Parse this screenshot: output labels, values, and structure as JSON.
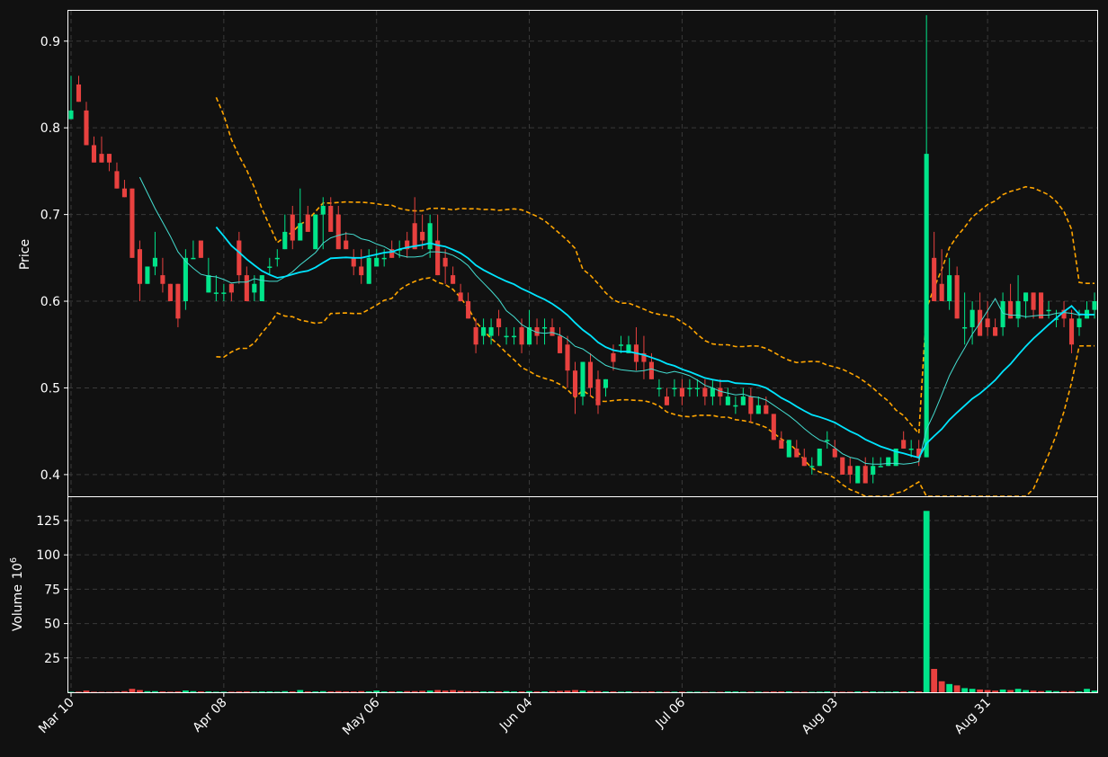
{
  "chart_data": {
    "type": "candlestick",
    "colors": {
      "background": "#111111",
      "up": "#00e58a",
      "down": "#e8413f",
      "ma_long": "#00e5ff",
      "ma_short": "#44ddd0",
      "band": "#ffa500",
      "grid": "#3a3a3a",
      "axis": "#ffffff"
    },
    "x_tick_labels": [
      "Mar 10",
      "Apr 08",
      "May 06",
      "Jun 04",
      "Jul 06",
      "Aug 03",
      "Aug 31"
    ],
    "price_axis": {
      "label": "Price",
      "ylim": [
        0.375,
        0.935
      ],
      "ticks": [
        "0.4",
        "0.5",
        "0.6",
        "0.7",
        "0.8",
        "0.9"
      ]
    },
    "volume_axis": {
      "label": "Volume",
      "unit": "10^6",
      "ylim": [
        0,
        142
      ],
      "ticks": [
        "25",
        "50",
        "75",
        "100",
        "125"
      ]
    },
    "grid": true,
    "candles": {
      "columns": [
        "open",
        "high",
        "low",
        "close",
        "volume_millions"
      ],
      "rows": [
        [
          0.81,
          0.86,
          0.81,
          0.82,
          0.3
        ],
        [
          0.85,
          0.86,
          0.83,
          0.83,
          0.4
        ],
        [
          0.82,
          0.83,
          0.78,
          0.78,
          1.2
        ],
        [
          0.78,
          0.79,
          0.76,
          0.76,
          0.4
        ],
        [
          0.77,
          0.79,
          0.76,
          0.76,
          0.3
        ],
        [
          0.77,
          0.77,
          0.75,
          0.76,
          0.3
        ],
        [
          0.75,
          0.76,
          0.73,
          0.73,
          0.4
        ],
        [
          0.73,
          0.74,
          0.72,
          0.72,
          0.8
        ],
        [
          0.73,
          0.73,
          0.65,
          0.65,
          2.5
        ],
        [
          0.66,
          0.67,
          0.6,
          0.62,
          1.6
        ],
        [
          0.62,
          0.64,
          0.62,
          0.64,
          0.8
        ],
        [
          0.64,
          0.68,
          0.63,
          0.65,
          0.8
        ],
        [
          0.63,
          0.65,
          0.61,
          0.62,
          0.6
        ],
        [
          0.62,
          0.62,
          0.6,
          0.6,
          0.4
        ],
        [
          0.62,
          0.62,
          0.57,
          0.58,
          0.6
        ],
        [
          0.6,
          0.66,
          0.59,
          0.65,
          1.3
        ],
        [
          0.65,
          0.67,
          0.65,
          0.65,
          0.8
        ],
        [
          0.67,
          0.67,
          0.65,
          0.65,
          0.6
        ],
        [
          0.61,
          0.65,
          0.61,
          0.63,
          0.6
        ],
        [
          0.61,
          0.63,
          0.6,
          0.61,
          0.4
        ],
        [
          0.61,
          0.62,
          0.6,
          0.61,
          0.4
        ],
        [
          0.62,
          0.62,
          0.6,
          0.61,
          0.4
        ],
        [
          0.67,
          0.68,
          0.62,
          0.63,
          0.6
        ],
        [
          0.63,
          0.64,
          0.6,
          0.6,
          0.6
        ],
        [
          0.61,
          0.63,
          0.6,
          0.62,
          0.4
        ],
        [
          0.6,
          0.63,
          0.6,
          0.63,
          0.6
        ],
        [
          0.64,
          0.65,
          0.63,
          0.64,
          0.6
        ],
        [
          0.65,
          0.66,
          0.64,
          0.65,
          0.4
        ],
        [
          0.66,
          0.7,
          0.66,
          0.68,
          0.8
        ],
        [
          0.7,
          0.71,
          0.66,
          0.67,
          0.6
        ],
        [
          0.67,
          0.73,
          0.67,
          0.69,
          1.6
        ],
        [
          0.7,
          0.71,
          0.68,
          0.68,
          0.6
        ],
        [
          0.66,
          0.7,
          0.66,
          0.7,
          0.6
        ],
        [
          0.7,
          0.72,
          0.66,
          0.71,
          0.8
        ],
        [
          0.71,
          0.72,
          0.69,
          0.68,
          0.6
        ],
        [
          0.7,
          0.71,
          0.66,
          0.66,
          0.8
        ],
        [
          0.67,
          0.68,
          0.66,
          0.66,
          0.6
        ],
        [
          0.65,
          0.66,
          0.63,
          0.64,
          0.6
        ],
        [
          0.64,
          0.66,
          0.62,
          0.63,
          0.8
        ],
        [
          0.62,
          0.66,
          0.62,
          0.65,
          0.6
        ],
        [
          0.64,
          0.66,
          0.64,
          0.65,
          1.2
        ],
        [
          0.65,
          0.66,
          0.64,
          0.65,
          0.6
        ],
        [
          0.66,
          0.67,
          0.65,
          0.65,
          0.6
        ],
        [
          0.66,
          0.67,
          0.65,
          0.66,
          0.6
        ],
        [
          0.67,
          0.68,
          0.65,
          0.66,
          0.8
        ],
        [
          0.69,
          0.72,
          0.66,
          0.66,
          0.8
        ],
        [
          0.68,
          0.7,
          0.66,
          0.67,
          1.0
        ],
        [
          0.66,
          0.7,
          0.65,
          0.69,
          1.2
        ],
        [
          0.67,
          0.7,
          0.63,
          0.63,
          1.6
        ],
        [
          0.65,
          0.66,
          0.62,
          0.64,
          1.2
        ],
        [
          0.63,
          0.64,
          0.62,
          0.62,
          1.6
        ],
        [
          0.61,
          0.62,
          0.6,
          0.6,
          1.0
        ],
        [
          0.6,
          0.61,
          0.58,
          0.58,
          0.8
        ],
        [
          0.57,
          0.58,
          0.54,
          0.55,
          0.6
        ],
        [
          0.56,
          0.58,
          0.55,
          0.57,
          0.6
        ],
        [
          0.56,
          0.58,
          0.55,
          0.57,
          0.6
        ],
        [
          0.58,
          0.59,
          0.56,
          0.57,
          0.6
        ],
        [
          0.56,
          0.57,
          0.55,
          0.56,
          0.8
        ],
        [
          0.56,
          0.57,
          0.55,
          0.56,
          0.6
        ],
        [
          0.57,
          0.58,
          0.54,
          0.55,
          0.6
        ],
        [
          0.55,
          0.59,
          0.55,
          0.57,
          0.8
        ],
        [
          0.57,
          0.58,
          0.55,
          0.56,
          0.6
        ],
        [
          0.57,
          0.58,
          0.55,
          0.57,
          0.6
        ],
        [
          0.57,
          0.58,
          0.56,
          0.56,
          0.8
        ],
        [
          0.56,
          0.57,
          0.54,
          0.54,
          1.0
        ],
        [
          0.55,
          0.56,
          0.5,
          0.52,
          1.2
        ],
        [
          0.52,
          0.53,
          0.47,
          0.49,
          1.6
        ],
        [
          0.49,
          0.53,
          0.48,
          0.53,
          1.2
        ],
        [
          0.53,
          0.54,
          0.49,
          0.5,
          1.0
        ],
        [
          0.51,
          0.52,
          0.47,
          0.48,
          0.8
        ],
        [
          0.5,
          0.51,
          0.49,
          0.51,
          0.6
        ],
        [
          0.54,
          0.55,
          0.52,
          0.53,
          0.6
        ],
        [
          0.55,
          0.56,
          0.54,
          0.55,
          0.4
        ],
        [
          0.54,
          0.56,
          0.54,
          0.55,
          0.6
        ],
        [
          0.55,
          0.57,
          0.52,
          0.53,
          0.4
        ],
        [
          0.54,
          0.56,
          0.51,
          0.53,
          0.4
        ],
        [
          0.53,
          0.54,
          0.51,
          0.51,
          0.6
        ],
        [
          0.5,
          0.51,
          0.49,
          0.5,
          0.4
        ],
        [
          0.49,
          0.5,
          0.48,
          0.48,
          0.4
        ],
        [
          0.5,
          0.51,
          0.49,
          0.5,
          0.4
        ],
        [
          0.5,
          0.51,
          0.48,
          0.49,
          0.4
        ],
        [
          0.5,
          0.51,
          0.49,
          0.5,
          0.4
        ],
        [
          0.5,
          0.51,
          0.49,
          0.5,
          0.4
        ],
        [
          0.5,
          0.51,
          0.48,
          0.49,
          0.3
        ],
        [
          0.49,
          0.51,
          0.48,
          0.5,
          0.3
        ],
        [
          0.5,
          0.51,
          0.48,
          0.49,
          0.3
        ],
        [
          0.48,
          0.5,
          0.48,
          0.49,
          0.6
        ],
        [
          0.48,
          0.49,
          0.47,
          0.48,
          0.6
        ],
        [
          0.48,
          0.5,
          0.48,
          0.49,
          0.4
        ],
        [
          0.49,
          0.5,
          0.46,
          0.47,
          0.4
        ],
        [
          0.47,
          0.49,
          0.47,
          0.48,
          0.4
        ],
        [
          0.48,
          0.49,
          0.47,
          0.47,
          0.4
        ],
        [
          0.47,
          0.47,
          0.44,
          0.44,
          0.6
        ],
        [
          0.44,
          0.45,
          0.43,
          0.43,
          0.6
        ],
        [
          0.42,
          0.44,
          0.42,
          0.44,
          0.6
        ],
        [
          0.43,
          0.44,
          0.42,
          0.42,
          0.4
        ],
        [
          0.42,
          0.43,
          0.41,
          0.41,
          0.4
        ],
        [
          0.41,
          0.42,
          0.4,
          0.41,
          0.3
        ],
        [
          0.41,
          0.43,
          0.41,
          0.43,
          0.4
        ],
        [
          0.44,
          0.45,
          0.43,
          0.44,
          0.6
        ],
        [
          0.43,
          0.44,
          0.42,
          0.42,
          0.4
        ],
        [
          0.42,
          0.42,
          0.4,
          0.4,
          0.4
        ],
        [
          0.41,
          0.42,
          0.39,
          0.4,
          0.4
        ],
        [
          0.39,
          0.41,
          0.39,
          0.41,
          0.6
        ],
        [
          0.41,
          0.42,
          0.39,
          0.39,
          0.6
        ],
        [
          0.4,
          0.42,
          0.39,
          0.41,
          0.6
        ],
        [
          0.41,
          0.42,
          0.41,
          0.41,
          0.4
        ],
        [
          0.41,
          0.42,
          0.41,
          0.42,
          0.4
        ],
        [
          0.41,
          0.43,
          0.41,
          0.43,
          0.6
        ],
        [
          0.44,
          0.45,
          0.43,
          0.43,
          0.6
        ],
        [
          0.43,
          0.44,
          0.42,
          0.43,
          0.6
        ],
        [
          0.43,
          0.44,
          0.41,
          0.42,
          0.6
        ],
        [
          0.42,
          0.93,
          0.42,
          0.77,
          132
        ],
        [
          0.65,
          0.68,
          0.6,
          0.6,
          17
        ],
        [
          0.62,
          0.66,
          0.6,
          0.6,
          8
        ],
        [
          0.6,
          0.65,
          0.59,
          0.63,
          6
        ],
        [
          0.63,
          0.64,
          0.58,
          0.58,
          5
        ],
        [
          0.57,
          0.61,
          0.55,
          0.57,
          3
        ],
        [
          0.57,
          0.6,
          0.55,
          0.59,
          2.5
        ],
        [
          0.59,
          0.61,
          0.57,
          0.56,
          2
        ],
        [
          0.58,
          0.6,
          0.56,
          0.57,
          1.6
        ],
        [
          0.57,
          0.58,
          0.56,
          0.56,
          1.2
        ],
        [
          0.57,
          0.61,
          0.56,
          0.6,
          2
        ],
        [
          0.6,
          0.62,
          0.58,
          0.58,
          1.6
        ],
        [
          0.58,
          0.63,
          0.57,
          0.6,
          2.5
        ],
        [
          0.6,
          0.61,
          0.58,
          0.61,
          1.6
        ],
        [
          0.61,
          0.61,
          0.58,
          0.59,
          1.2
        ],
        [
          0.61,
          0.61,
          0.58,
          0.58,
          0.8
        ],
        [
          0.59,
          0.6,
          0.58,
          0.59,
          1.2
        ],
        [
          0.58,
          0.59,
          0.57,
          0.58,
          0.8
        ],
        [
          0.59,
          0.6,
          0.57,
          0.58,
          0.8
        ],
        [
          0.58,
          0.59,
          0.54,
          0.55,
          0.8
        ],
        [
          0.57,
          0.59,
          0.56,
          0.58,
          0.6
        ],
        [
          0.58,
          0.6,
          0.58,
          0.59,
          2.5
        ],
        [
          0.59,
          0.61,
          0.58,
          0.6,
          1.2
        ]
      ]
    }
  }
}
